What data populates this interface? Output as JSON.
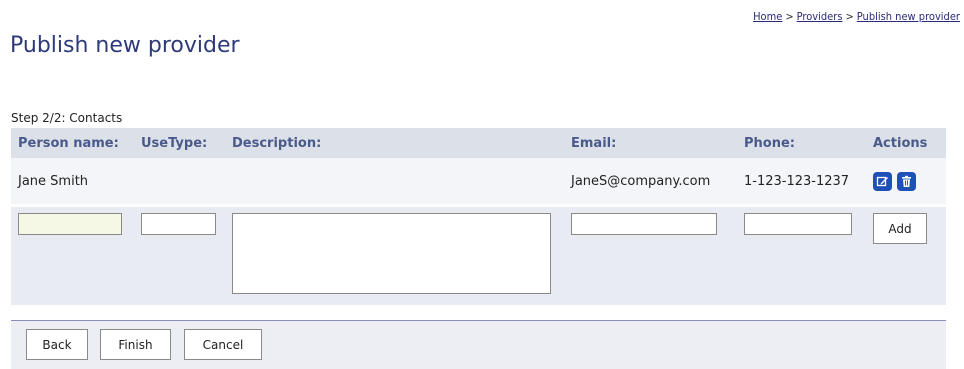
{
  "page": {
    "title": "Publish new provider",
    "step": "Step 2/2: Contacts"
  },
  "breadcrumb": {
    "home": "Home",
    "providers": "Providers",
    "current": "Publish new provider",
    "separator": ">"
  },
  "table": {
    "headers": {
      "person_name": "Person name:",
      "use_type": "UseType:",
      "description": "Description:",
      "email": "Email:",
      "phone": "Phone:",
      "actions": "Actions"
    },
    "rows": [
      {
        "person_name": "Jane Smith",
        "use_type": "",
        "description": "",
        "email": "JaneS@company.com",
        "phone": "1-123-123-1237",
        "actions": [
          "edit-icon",
          "delete-icon"
        ]
      }
    ],
    "new_row": {
      "person_name": "",
      "use_type": "",
      "description": "",
      "email": "",
      "phone": "",
      "add_label": "Add"
    }
  },
  "footer": {
    "back_label": "Back",
    "finish_label": "Finish",
    "cancel_label": "Cancel"
  },
  "colors": {
    "title": "#2f3a7a",
    "header_bg": "#dce0e8",
    "header_text": "#4a5a8a",
    "icon_button": "#1f4fb8"
  }
}
